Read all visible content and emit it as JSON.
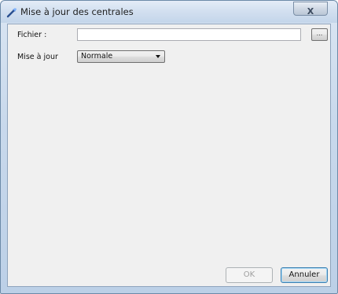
{
  "window": {
    "title": "Mise à jour des centrales",
    "close_glyph": "X",
    "icon": "wand-icon"
  },
  "form": {
    "file_label": "Fichier :",
    "file_value": "",
    "browse_label": "...",
    "update_label": "Mise à jour",
    "update_value": "Normale"
  },
  "footer": {
    "ok_label": "OK",
    "cancel_label": "Annuler"
  }
}
